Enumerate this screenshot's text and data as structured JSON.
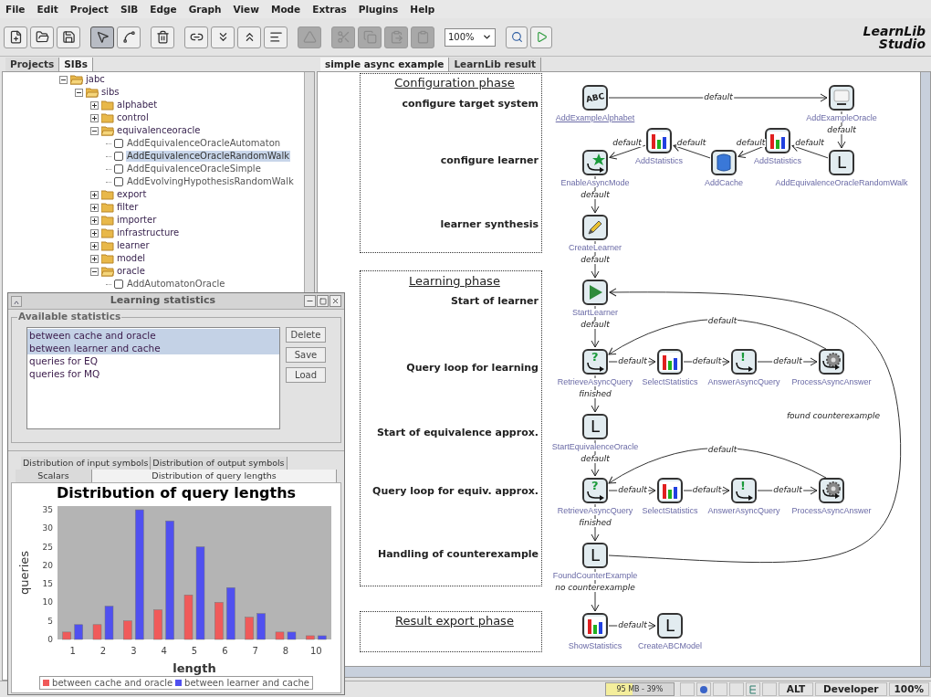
{
  "menu": [
    "File",
    "Edit",
    "Project",
    "SIB",
    "Edge",
    "Graph",
    "View",
    "Mode",
    "Extras",
    "Plugins",
    "Help"
  ],
  "toolbar": {
    "groups": [
      [
        {
          "selected": false,
          "disabled": false
        },
        {
          "selected": false,
          "disabled": false
        },
        {
          "selected": false,
          "disabled": false
        }
      ],
      [
        {
          "selected": true,
          "disabled": false
        },
        {
          "selected": false,
          "disabled": false
        }
      ],
      [
        {
          "selected": false,
          "disabled": false
        }
      ],
      [
        {
          "selected": false,
          "disabled": false
        },
        {
          "selected": false,
          "disabled": false
        },
        {
          "selected": false,
          "disabled": false
        },
        {
          "selected": false,
          "disabled": false
        }
      ],
      [
        {
          "selected": false,
          "disabled": true
        }
      ],
      [
        {
          "selected": false,
          "disabled": true
        },
        {
          "selected": false,
          "disabled": true
        },
        {
          "selected": false,
          "disabled": true
        },
        {
          "selected": false,
          "disabled": true
        }
      ]
    ],
    "zoom": "100%",
    "tools": [
      {
        "selected": false,
        "disabled": false
      },
      {
        "selected": false,
        "disabled": false
      }
    ],
    "logo": [
      "LearnLib",
      "Studio"
    ]
  },
  "left_tabs": [
    {
      "label": "Projects",
      "selected": false
    },
    {
      "label": "SIBs",
      "selected": true
    }
  ],
  "tree": [
    {
      "label": "jabc",
      "kind": "folder",
      "expanded": true,
      "children": [
        {
          "label": "sibs",
          "kind": "folder",
          "expanded": true,
          "children": [
            {
              "label": "alphabet",
              "kind": "folder",
              "expanded": false
            },
            {
              "label": "control",
              "kind": "folder",
              "expanded": false
            },
            {
              "label": "equivalenceoracle",
              "kind": "folder",
              "expanded": true,
              "children": [
                {
                  "label": "AddEquivalenceOracleAutomaton",
                  "kind": "sib",
                  "selected": false
                },
                {
                  "label": "AddEquivalenceOracleRandomWalk",
                  "kind": "sib",
                  "selected": true
                },
                {
                  "label": "AddEquivalenceOracleSimple",
                  "kind": "sib",
                  "selected": false
                },
                {
                  "label": "AddEvolvingHypothesisRandomWalk",
                  "kind": "sib",
                  "selected": false
                }
              ]
            },
            {
              "label": "export",
              "kind": "folder",
              "expanded": false
            },
            {
              "label": "filter",
              "kind": "folder",
              "expanded": false
            },
            {
              "label": "importer",
              "kind": "folder",
              "expanded": false
            },
            {
              "label": "infrastructure",
              "kind": "folder",
              "expanded": false
            },
            {
              "label": "learner",
              "kind": "folder",
              "expanded": false
            },
            {
              "label": "model",
              "kind": "folder",
              "expanded": false
            },
            {
              "label": "oracle",
              "kind": "folder",
              "expanded": true,
              "children": [
                {
                  "label": "AddAutomatonOracle",
                  "kind": "sib",
                  "selected": false
                }
              ]
            }
          ]
        }
      ]
    }
  ],
  "editor_tabs": [
    {
      "label": "simple async example",
      "selected": true
    },
    {
      "label": "LearnLib result",
      "selected": false
    }
  ],
  "diagram": {
    "phases": [
      {
        "title": "Configuration phase",
        "steps": [
          "configure target system",
          "configure learner",
          "learner synthesis"
        ]
      },
      {
        "title": "Learning phase",
        "steps": [
          "Start of learner",
          "Query loop for learning",
          "Start of equivalence approx.",
          "Query loop for equiv. approx.",
          "Handling of counterexample"
        ]
      },
      {
        "title": "Result export phase"
      }
    ],
    "nodes": [
      {
        "label": "AddExampleAlphabet",
        "kind": "letters",
        "glyph": "ABC",
        "start": true
      },
      {
        "label": "AddExampleOracle",
        "kind": "monitor",
        "start": false
      },
      {
        "label": "AddStatistics",
        "kind": "chart",
        "start": false
      },
      {
        "label": "AddStatistics",
        "kind": "chart",
        "start": false
      },
      {
        "label": "EnableAsyncMode",
        "kind": "star_loop",
        "start": false
      },
      {
        "label": "AddCache",
        "kind": "database",
        "start": false
      },
      {
        "label": "AddEquivalenceOracleRandomWalk",
        "kind": "letter",
        "glyph": "L",
        "start": false
      },
      {
        "label": "CreateLearner",
        "kind": "pencil",
        "start": false
      },
      {
        "label": "StartLearner",
        "kind": "play",
        "start": false
      },
      {
        "label": "RetrieveAsyncQuery",
        "kind": "async",
        "glyph": "?",
        "start": false
      },
      {
        "label": "SelectStatistics",
        "kind": "chart",
        "start": false
      },
      {
        "label": "AnswerAsyncQuery",
        "kind": "async",
        "glyph": "!",
        "start": false
      },
      {
        "label": "ProcessAsyncAnswer",
        "kind": "gear",
        "start": false
      },
      {
        "label": "StartEquivalenceOracle",
        "kind": "letter",
        "glyph": "L",
        "start": false
      },
      {
        "label": "RetrieveAsyncQuery",
        "kind": "async",
        "glyph": "?",
        "start": false
      },
      {
        "label": "SelectStatistics",
        "kind": "chart",
        "start": false
      },
      {
        "label": "AnswerAsyncQuery",
        "kind": "async",
        "glyph": "!",
        "start": false
      },
      {
        "label": "ProcessAsyncAnswer",
        "kind": "gear",
        "start": false
      },
      {
        "label": "FoundCounterExample",
        "kind": "letter",
        "glyph": "L",
        "start": false
      },
      {
        "label": "ShowStatistics",
        "kind": "chart",
        "start": false
      },
      {
        "label": "CreateABCModel",
        "kind": "letter",
        "glyph": "L",
        "start": false
      }
    ],
    "edges": [
      {
        "label": "default",
        "kind": "straight"
      },
      {
        "label": "default",
        "kind": "straight"
      },
      {
        "label": "default",
        "kind": "straight"
      },
      {
        "label": "default",
        "kind": "straight"
      },
      {
        "label": "default",
        "kind": "straight"
      },
      {
        "label": "default",
        "kind": "straight"
      },
      {
        "label": "default",
        "kind": "straight"
      },
      {
        "label": "default",
        "kind": "straight"
      },
      {
        "label": "default",
        "kind": "straight"
      },
      {
        "label": "default",
        "kind": "loop"
      },
      {
        "label": "default",
        "kind": "straight"
      },
      {
        "label": "default",
        "kind": "straight"
      },
      {
        "label": "default",
        "kind": "straight"
      },
      {
        "label": "finished",
        "kind": "straight"
      },
      {
        "label": "found counterexample",
        "kind": "outer"
      },
      {
        "label": "default",
        "kind": "straight"
      },
      {
        "label": "default",
        "kind": "loop"
      },
      {
        "label": "default",
        "kind": "straight"
      },
      {
        "label": "default",
        "kind": "straight"
      },
      {
        "label": "default",
        "kind": "straight"
      },
      {
        "label": "finished",
        "kind": "straight"
      },
      {
        "label": "no counterexample",
        "kind": "straight"
      },
      {
        "label": "default",
        "kind": "straight"
      }
    ]
  },
  "statistics_window": {
    "title": "Learning statistics",
    "group": "Available statistics",
    "items": [
      {
        "label": "between cache and oracle",
        "selected": true
      },
      {
        "label": "between learner and cache",
        "selected": true
      },
      {
        "label": "queries for EQ",
        "selected": false
      },
      {
        "label": "queries for MQ",
        "selected": false
      }
    ],
    "buttons": [
      "Delete",
      "Save",
      "Load"
    ],
    "tabs": [
      {
        "label": "Distribution of input symbols",
        "selected": false
      },
      {
        "label": "Distribution of output symbols",
        "selected": false
      },
      {
        "label": "Scalars",
        "selected": false
      },
      {
        "label": "Distribution of query lengths",
        "selected": true
      }
    ],
    "chart_data": {
      "type": "bar",
      "title": "Distribution of query lengths",
      "xlabel": "length",
      "ylabel": "queries",
      "categories": [
        "1",
        "2",
        "3",
        "4",
        "5",
        "6",
        "7",
        "8",
        "10"
      ],
      "series": [
        {
          "name": "between cache and oracle",
          "color": "#f05a5a",
          "values": [
            2,
            4,
            5,
            8,
            12,
            10,
            6,
            2,
            1
          ]
        },
        {
          "name": "between learner and cache",
          "color": "#5050f0",
          "values": [
            4,
            9,
            35,
            32,
            25,
            14,
            7,
            2,
            1
          ]
        }
      ],
      "ylim": [
        0,
        36
      ],
      "yticks": [
        0,
        5,
        10,
        15,
        20,
        25,
        30,
        35
      ],
      "legend": "bottom"
    }
  },
  "status_bar": {
    "memory": {
      "text": "95 MB - 39%",
      "level": 0.39
    },
    "mode": "ALT",
    "role": "Developer",
    "zoom": "100%"
  }
}
